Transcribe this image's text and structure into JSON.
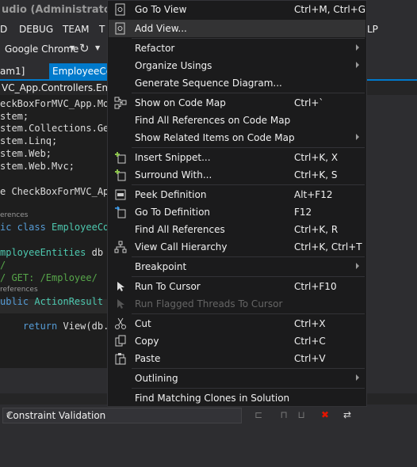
{
  "window": {
    "title": "udio (Administrator)"
  },
  "menubar": {
    "items": [
      "D",
      "DEBUG",
      "TEAM",
      "T",
      "LP"
    ]
  },
  "toolbar": {
    "browser": "Google Chrome"
  },
  "tabs": {
    "tab0": "am1]",
    "tab1": "EmployeeCon"
  },
  "navbar": {
    "text": "VC_App.Controllers.Employee"
  },
  "code": {
    "lines": [
      "eckBoxForMVC_App.Mod",
      "stem;",
      "stem.Collections.Gen",
      "stem.Linq;",
      "stem.Web;",
      "stem.Web.Mvc;",
      "e CheckBoxForMVC_App",
      "erences",
      "ic class EmployeeCon",
      "mployeeEntities db",
      "/",
      "/ GET: /Employee/",
      "references",
      "ublic ActionResult",
      "return View(db.D"
    ]
  },
  "panel": {
    "combo_value": "Constraint Validation"
  },
  "context_menu": {
    "items": [
      {
        "label": "Go To View",
        "shortcut": "Ctrl+M, Ctrl+G",
        "icon": "view-icon",
        "submenu": false,
        "disabled": false
      },
      {
        "label": "Add View...",
        "shortcut": "",
        "icon": "add-view-icon",
        "submenu": false,
        "disabled": false,
        "hover": true
      },
      {
        "label": "Refactor",
        "shortcut": "",
        "icon": "",
        "submenu": true,
        "disabled": false
      },
      {
        "label": "Organize Usings",
        "shortcut": "",
        "icon": "",
        "submenu": true,
        "disabled": false
      },
      {
        "label": "Generate Sequence Diagram...",
        "shortcut": "",
        "icon": "",
        "submenu": false,
        "disabled": false
      },
      {
        "label": "Show on Code Map",
        "shortcut": "Ctrl+`",
        "icon": "code-map-icon",
        "submenu": false,
        "disabled": false
      },
      {
        "label": "Find All References on Code Map",
        "shortcut": "",
        "icon": "",
        "submenu": false,
        "disabled": false
      },
      {
        "label": "Show Related Items on Code Map",
        "shortcut": "",
        "icon": "",
        "submenu": true,
        "disabled": false
      },
      {
        "label": "Insert Snippet...",
        "shortcut": "Ctrl+K, X",
        "icon": "snippet-icon",
        "submenu": false,
        "disabled": false
      },
      {
        "label": "Surround With...",
        "shortcut": "Ctrl+K, S",
        "icon": "surround-icon",
        "submenu": false,
        "disabled": false
      },
      {
        "label": "Peek Definition",
        "shortcut": "Alt+F12",
        "icon": "peek-icon",
        "submenu": false,
        "disabled": false
      },
      {
        "label": "Go To Definition",
        "shortcut": "F12",
        "icon": "goto-definition-icon",
        "submenu": false,
        "disabled": false
      },
      {
        "label": "Find All References",
        "shortcut": "Ctrl+K, R",
        "icon": "",
        "submenu": false,
        "disabled": false
      },
      {
        "label": "View Call Hierarchy",
        "shortcut": "Ctrl+K, Ctrl+T",
        "icon": "call-hierarchy-icon",
        "submenu": false,
        "disabled": false
      },
      {
        "label": "Breakpoint",
        "shortcut": "",
        "icon": "",
        "submenu": true,
        "disabled": false
      },
      {
        "label": "Run To Cursor",
        "shortcut": "Ctrl+F10",
        "icon": "cursor-icon",
        "submenu": false,
        "disabled": false
      },
      {
        "label": "Run Flagged Threads To Cursor",
        "shortcut": "",
        "icon": "cursor-flag-icon",
        "submenu": false,
        "disabled": true
      },
      {
        "label": "Cut",
        "shortcut": "Ctrl+X",
        "icon": "scissors-icon",
        "submenu": false,
        "disabled": false
      },
      {
        "label": "Copy",
        "shortcut": "Ctrl+C",
        "icon": "copy-icon",
        "submenu": false,
        "disabled": false
      },
      {
        "label": "Paste",
        "shortcut": "Ctrl+V",
        "icon": "paste-icon",
        "submenu": false,
        "disabled": false
      },
      {
        "label": "Outlining",
        "shortcut": "",
        "icon": "",
        "submenu": true,
        "disabled": false
      },
      {
        "label": "Find Matching Clones in Solution",
        "shortcut": "",
        "icon": "",
        "submenu": false,
        "disabled": false
      }
    ]
  }
}
